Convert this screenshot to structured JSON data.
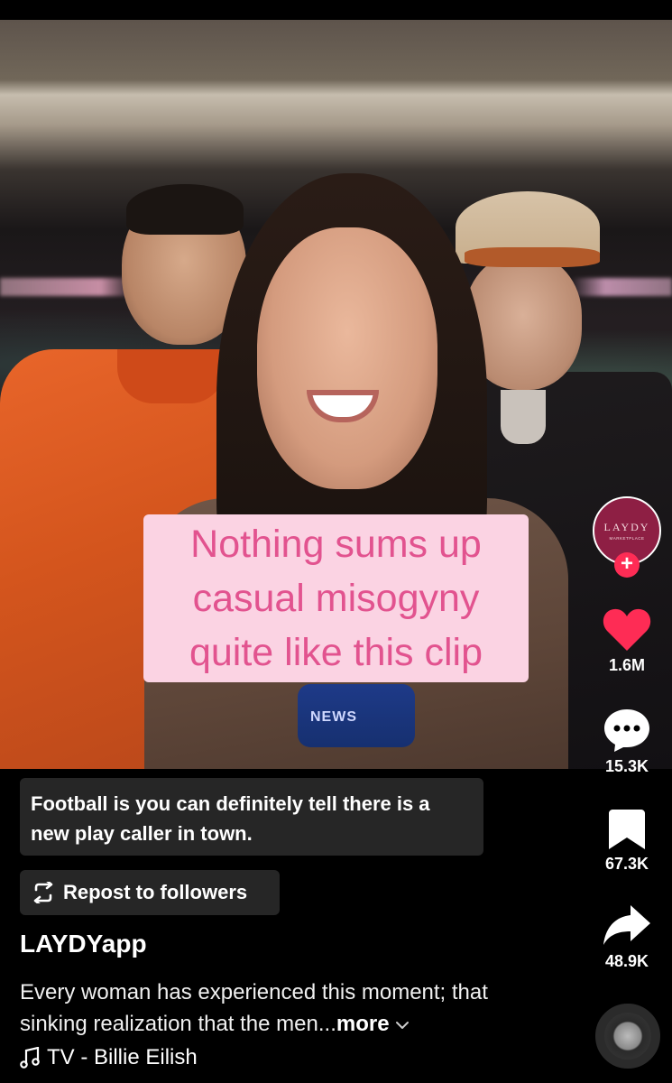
{
  "overlay_text": "Nothing sums up casual misogyny quite like this clip",
  "mic_label": "NEWS",
  "creator_avatar": {
    "brand": "LAYDY",
    "sub": "MARKETPLACE"
  },
  "actions": {
    "likes": "1.6M",
    "comments": "15.3K",
    "saves": "67.3K",
    "shares": "48.9K"
  },
  "post_caption": "Football is you can definitely tell there is a new play caller in town.",
  "repost_label": "Repost to followers",
  "username": "LAYDYapp",
  "description": "Every woman has experienced this moment; that sinking realization that the men...",
  "more_label": "more",
  "sound": "TV - Billie Eilish",
  "colors": {
    "like": "#fe2c55",
    "overlay_bg": "#fbd3e3",
    "overlay_text": "#e2538f",
    "panel": "#262626"
  }
}
